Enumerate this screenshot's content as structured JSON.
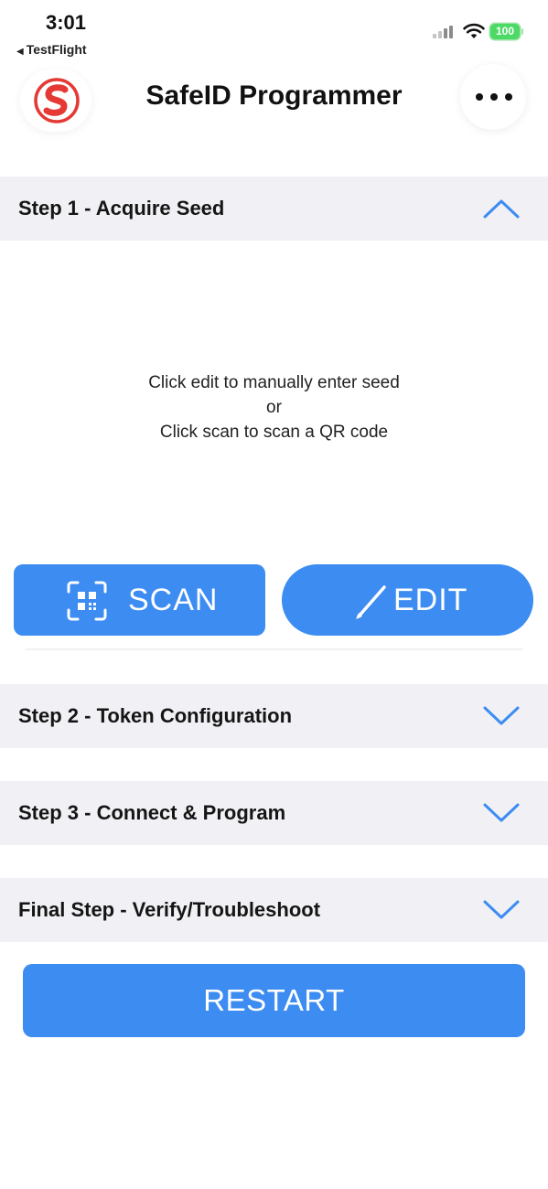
{
  "status_bar": {
    "time": "3:01",
    "back_app": "TestFlight",
    "battery": "100"
  },
  "header": {
    "title": "SafeID Programmer",
    "logo_letter": "S"
  },
  "steps": [
    {
      "label": "Step 1 - Acquire Seed",
      "expanded": true
    },
    {
      "label": "Step 2 - Token Configuration",
      "expanded": false
    },
    {
      "label": "Step 3 - Connect & Program",
      "expanded": false
    },
    {
      "label": "Final Step - Verify/Troubleshoot",
      "expanded": false
    }
  ],
  "step1": {
    "instruction_line1": "Click edit to manually enter seed",
    "instruction_line2": "or",
    "instruction_line3": "Click scan to scan a QR code",
    "scan_label": "SCAN",
    "edit_label": "EDIT"
  },
  "restart_label": "RESTART",
  "colors": {
    "accent": "#3c8cf2",
    "logo_red": "#e53935",
    "section_bg": "#f1f1f5",
    "battery_green": "#4cd964"
  }
}
